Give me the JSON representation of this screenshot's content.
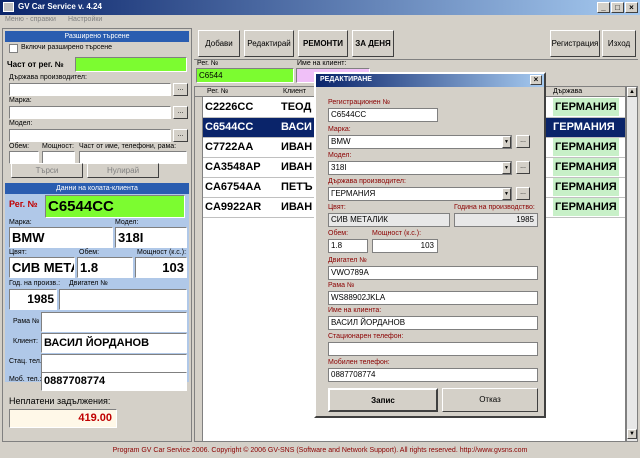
{
  "window": {
    "title": "GV Car Service v. 4.24"
  },
  "menu": [
    "Меню - справки",
    "Настройки"
  ],
  "left": {
    "ext_search_header": "Разширено търсене",
    "ext_checkbox_label": "Включи разширено търсене",
    "part_reg_label": "Част от рег. №",
    "country_label": "Държава производител:",
    "make_label": "Марка:",
    "model_label": "Модел:",
    "volume_label": "Обем:",
    "power_label": "Мощност:",
    "name_part_label": "Част от име, телефони, рама:",
    "search_btn": "Търси",
    "reset_btn": "Нулирай",
    "car_header": "Данни на колата-клиента",
    "reg_label": "Рег. №",
    "reg_value": "C6544CC",
    "make2_label": "Марка:",
    "make2_value": "BMW",
    "model2_label": "Модел:",
    "model2_value": "318I",
    "color_label": "Цвят:",
    "color_value": "СИВ МЕТАЛ",
    "vol2_label": "Обем:",
    "vol2_value": "1.8",
    "pow2_label": "Мощност (к.с.):",
    "pow2_value": "103",
    "year_label": "Год. на произв.:",
    "year_value": "1985",
    "engine_label": "Двигател №",
    "engine_value": "",
    "frame_label": "Рама №",
    "frame_value": "",
    "client_label": "Клиент:",
    "client_value": "ВАСИЛ ЙОРДАНОВ",
    "phone_label": "Стац. тел.:",
    "phone_value": "",
    "mobile_label": "Моб. тел.:",
    "mobile_value": "0887708774",
    "unpaid_label": "Неплатени задължения:",
    "unpaid_value": "419.00"
  },
  "toolbar": {
    "add": "Добави",
    "edit": "Редактирай",
    "repairs": "РЕМОНТИ",
    "for_day": "ЗА ДЕНЯ",
    "register": "Регистрация",
    "exit": "Изход"
  },
  "filter": {
    "reg_label": "Рег. №",
    "reg_value": "C6544",
    "client_label": "Име на клиент:"
  },
  "grid": {
    "headers": [
      "Рег. №",
      "Клиент",
      "Държава"
    ],
    "rows": [
      {
        "reg": "C2226CC",
        "client": "ТЕОД",
        "country": "ГЕРМАНИЯ"
      },
      {
        "reg": "C6544CC",
        "client": "ВАСИ",
        "country": "ГЕРМАНИЯ"
      },
      {
        "reg": "C7722AA",
        "client": "ИВАН",
        "country": "ГЕРМАНИЯ"
      },
      {
        "reg": "CA3548AP",
        "client": "ИВАН",
        "country": "ГЕРМАНИЯ"
      },
      {
        "reg": "CA6754AA",
        "client": "ПЕТЪ",
        "country": "ГЕРМАНИЯ"
      },
      {
        "reg": "CA9922AR",
        "client": "ИВАН",
        "country": "ГЕРМАНИЯ"
      }
    ]
  },
  "dialog": {
    "title": "РЕДАКТИРАНЕ",
    "reg_label": "Регистрационен №",
    "reg_value": "C6544CC",
    "make_label": "Марка:",
    "make_value": "BMW",
    "model_label": "Модел:",
    "model_value": "318I",
    "country_label": "Държава производител:",
    "country_value": "ГЕРМАНИЯ",
    "color_label": "Цвят:",
    "color_value": "СИВ МЕТАЛИК",
    "year_label": "Година на производство:",
    "year_value": "1985",
    "vol_label": "Обем:",
    "vol_value": "1.8",
    "pow_label": "Мощност (к.с.):",
    "pow_value": "103",
    "engine_label": "Двигател №",
    "engine_value": "VWO789A",
    "frame_label": "Рама №",
    "frame_value": "WS88902JKLA",
    "client_label": "Име на клиента:",
    "client_value": "ВАСИЛ ЙОРДАНОВ",
    "phone_label": "Стационарен телефон:",
    "phone_value": "",
    "mobile_label": "Мобилен телефон:",
    "mobile_value": "0887708774",
    "save_btn": "Запис",
    "cancel_btn": "Отказ"
  },
  "status": "Program GV Car Service 2006. Copyright © 2006 GV-SNS (Software and Network Support). All rights reserved. http://www.gvsns.com"
}
